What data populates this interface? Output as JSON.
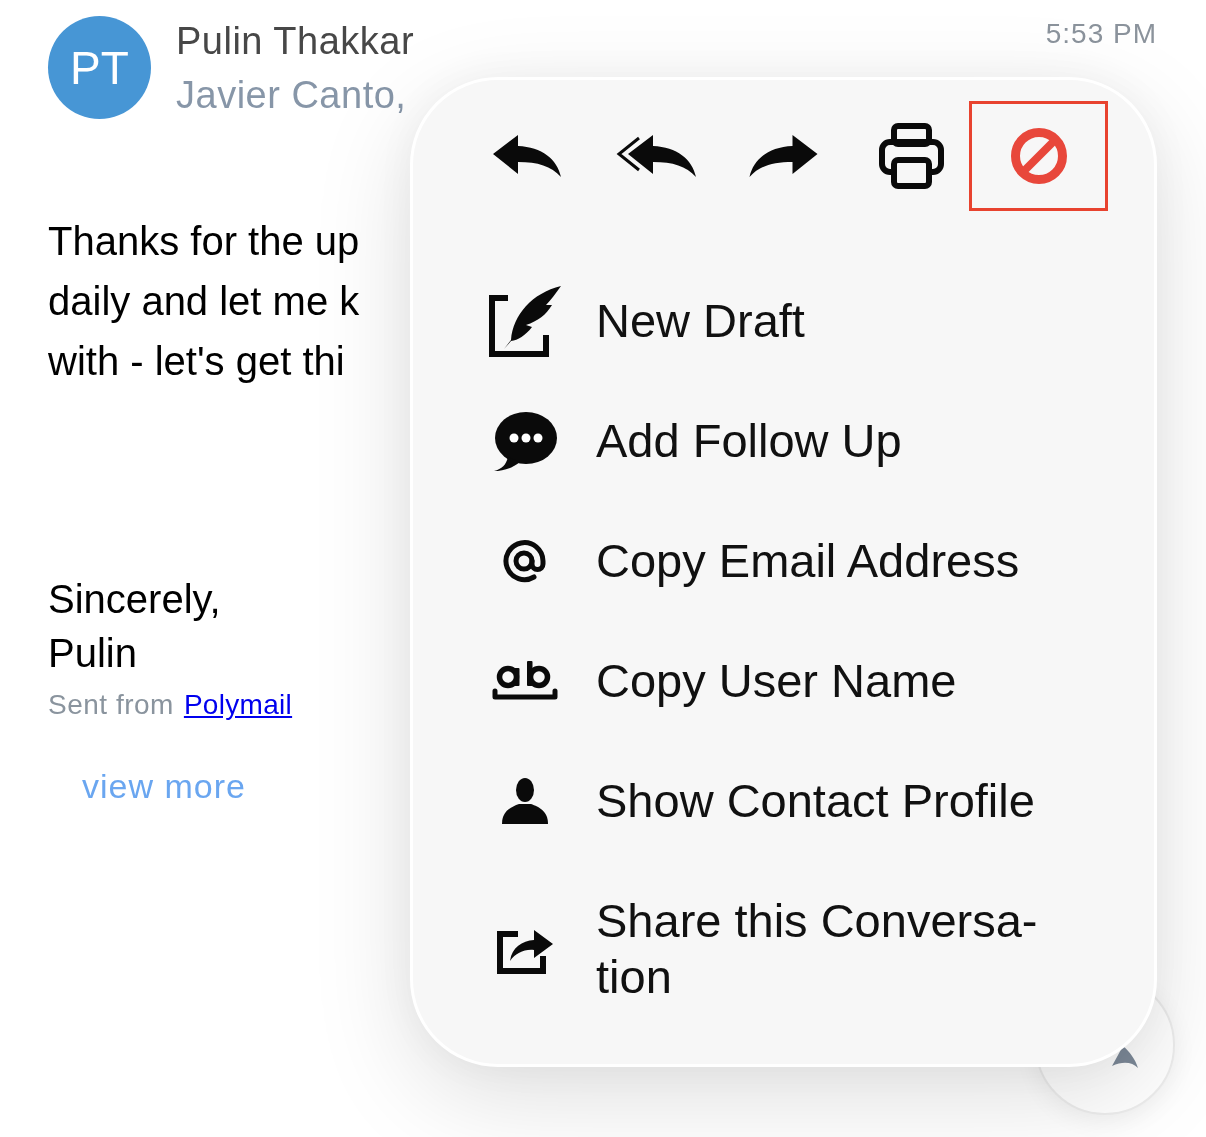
{
  "message": {
    "avatar_initials": "PT",
    "sender": "Pulin Thakkar",
    "recipients": "Javier Canto,",
    "time": "5:53 PM",
    "body_lines": [
      "Thanks for the up",
      "daily and let me k",
      "with - let's get thi"
    ],
    "signature_lines": [
      "Sincerely,",
      "Pulin"
    ],
    "sent_from": {
      "text": "Sent from",
      "link": "Polymail"
    },
    "view_more": "view more"
  },
  "action_menu": {
    "toolbar": [
      {
        "kind": "reply",
        "selected": false
      },
      {
        "kind": "reply_all",
        "selected": false
      },
      {
        "kind": "forward",
        "selected": false
      },
      {
        "kind": "print",
        "selected": false
      },
      {
        "kind": "block",
        "selected": true
      }
    ],
    "items": [
      {
        "kind": "new_draft",
        "label": "New Draft"
      },
      {
        "kind": "follow_up",
        "label": "Add Follow Up"
      },
      {
        "kind": "email",
        "label": "Copy Email Address"
      },
      {
        "kind": "username",
        "label": "Copy User Name"
      },
      {
        "kind": "contact",
        "label": "Show Contact Profile"
      },
      {
        "kind": "share",
        "label": "Share this Conversa-\ntion"
      }
    ]
  }
}
